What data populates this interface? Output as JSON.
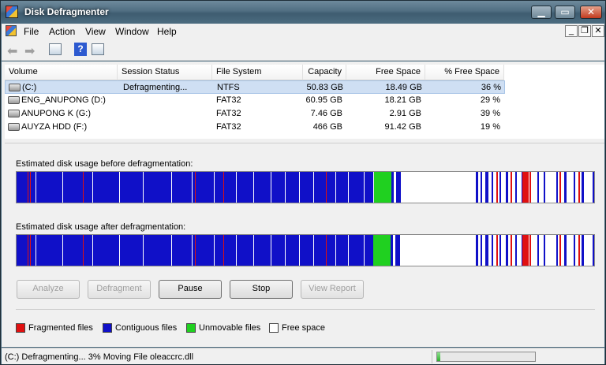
{
  "window": {
    "title": "Disk Defragmenter"
  },
  "menu": {
    "items": [
      "File",
      "Action",
      "View",
      "Window",
      "Help"
    ]
  },
  "list": {
    "columns": [
      "Volume",
      "Session Status",
      "File System",
      "Capacity",
      "Free Space",
      "% Free Space"
    ],
    "rows": [
      {
        "volume": "(C:)",
        "status": "Defragmenting...",
        "fs": "NTFS",
        "capacity": "50.83 GB",
        "free": "18.49 GB",
        "pct": "36 %",
        "selected": true
      },
      {
        "volume": "ENG_ANUPONG (D:)",
        "status": "",
        "fs": "FAT32",
        "capacity": "60.95 GB",
        "free": "18.21 GB",
        "pct": "29 %",
        "selected": false
      },
      {
        "volume": "ANUPONG K (G:)",
        "status": "",
        "fs": "FAT32",
        "capacity": "7.46 GB",
        "free": "2.91 GB",
        "pct": "39 %",
        "selected": false
      },
      {
        "volume": "AUYZA HDD (F:)",
        "status": "",
        "fs": "FAT32",
        "capacity": "466 GB",
        "free": "91.42 GB",
        "pct": "19 %",
        "selected": false
      }
    ]
  },
  "usage": {
    "before_label": "Estimated disk usage before defragmentation:",
    "after_label": "Estimated disk usage after defragmentation:"
  },
  "buttons": {
    "analyze": "Analyze",
    "defragment": "Defragment",
    "pause": "Pause",
    "stop": "Stop",
    "view_report": "View Report"
  },
  "legend": {
    "fragmented": "Fragmented files",
    "contiguous": "Contiguous files",
    "unmovable": "Unmovable files",
    "free": "Free space"
  },
  "colors": {
    "fragmented": "#e01010",
    "contiguous": "#1010c8",
    "unmovable": "#20d020",
    "free": "#ffffff"
  },
  "status": {
    "text": "(C:) Defragmenting... 3%  Moving File oleaccrc.dll",
    "progress_fraction": 0.03
  }
}
